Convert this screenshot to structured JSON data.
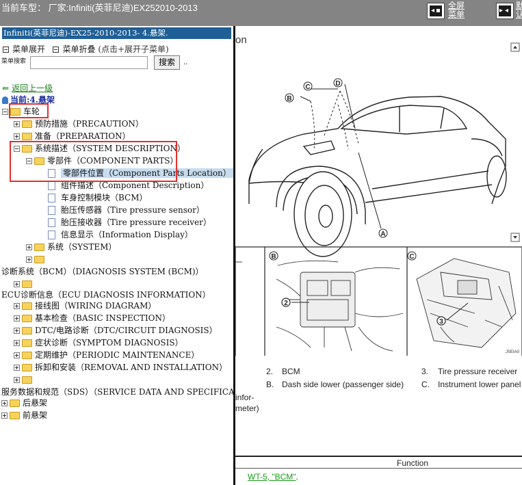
{
  "topbar": {
    "vehicle": "当前车型： 厂家:Infiniti(英菲尼迪)EX252010-2013",
    "fullscreen_line1": "全屏",
    "fullscreen_line2": "菜单",
    "right_line1": "默",
    "right_line2": "认"
  },
  "left": {
    "title": "Infiniti(英菲尼迪)-EX25-2010-2013- 4.悬架.",
    "expand_label": "菜单展开",
    "collapse_label": "菜单折叠",
    "collapse_hint": "(点击+展开子菜单)",
    "search_label": "菜单搜索",
    "search_button": "搜索",
    "search_dots": "..",
    "back_label": "返回上一级",
    "current_label": "当前:4.悬架"
  },
  "tree": {
    "wheels": "车轮",
    "precaution": "预防措施（PRECAUTION）",
    "preparation": "准备（PREPARATION）",
    "sysdesc": "系统描述（SYSTEM DESCRIPTION）",
    "component_parts": "零部件（COMPONENT PARTS）",
    "component_location": "零部件位置（Component Parts Location）",
    "component_description": "组件描述（Component Description）",
    "bcm": "车身控制模块（BCM）",
    "tire_sensor": "胎压传感器（Tire pressure sensor）",
    "tire_receiver": "胎压接收器（Tire pressure receiver）",
    "info_display": "信息显示（Information Display）",
    "system": "系统（SYSTEM）",
    "diagnosis_system": "诊断系统（BCM）（DIAGNOSIS SYSTEM (BCM)）",
    "ecu_diag": "ECU诊断信息（ECU DIAGNOSIS INFORMATION）",
    "wiring": "接线图（WIRING DIAGRAM）",
    "basic": "基本检查（BASIC INSPECTION）",
    "dtc": "DTC/电路诊断（DTC/CIRCUIT DIAGNOSIS）",
    "symptom": "症状诊断（SYMPTOM DIAGNOSIS）",
    "periodic": "定期维护（PERIODIC MAINTENANCE）",
    "removal": "拆卸和安装（REMOVAL AND INSTALLATION）",
    "sds": "服务数据和规范（SDS）（SERVICE DATA AND SPECIFICA",
    "rear_susp": "后悬架",
    "front_susp": "前悬架"
  },
  "right": {
    "title_fragment": "on",
    "callout_a": "A",
    "callout_b": "B",
    "callout_c": "C",
    "callout_d": "D",
    "panel_b": "B",
    "panel_c": "C",
    "num_2": "2",
    "num_3": "3",
    "figure_code": "JSEIA0",
    "legend_2_num": "2.",
    "legend_2_text": "BCM",
    "legend_3_num": "3.",
    "legend_3_text": "Tire pressure receiver",
    "legend_b_num": "B.",
    "legend_b_text": "Dash side lower (passenger side)",
    "legend_c_num": "C.",
    "legend_c_text": "Instrument lower panel",
    "frag_infor": "infor-",
    "frag_meter": "meter)",
    "function_header": "Function",
    "link": "WT-5, \"BCM\"",
    "link_period": "."
  }
}
